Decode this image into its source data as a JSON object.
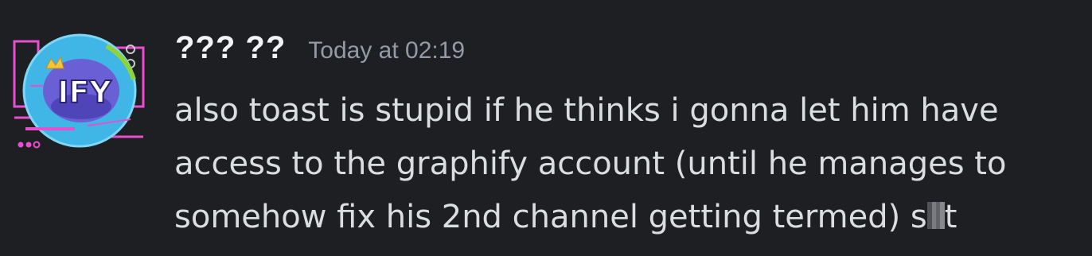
{
  "message": {
    "author": "??? ??",
    "timestamp": "Today at 02:19",
    "avatar": {
      "icon": "graphify-logo-avatar",
      "label": "IFY"
    },
    "content": {
      "line1": "also toast is stupid if he thinks i gonna let him have",
      "line2": "access to the graphify account (until he manages to",
      "line3_before_censor": "somehow fix his 2nd channel getting termed) s",
      "line3_after_censor": "t"
    }
  },
  "colors": {
    "background": "#1e1f22",
    "username": "#f2f3f5",
    "timestamp": "#949ba4",
    "message_text": "#dbdee1"
  }
}
